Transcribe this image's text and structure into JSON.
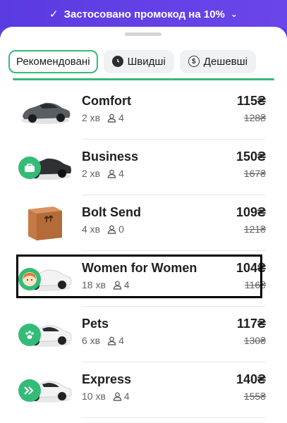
{
  "banner": {
    "text": "Застосовано промокод на 10%"
  },
  "filters": [
    {
      "label": "Рекомендовані",
      "active": true
    },
    {
      "label": "Швидші",
      "icon": "clock-icon"
    },
    {
      "label": "Дешевші",
      "icon": "dollar-icon"
    }
  ],
  "rides": [
    {
      "name": "Comfort",
      "eta": "2 хв",
      "seats": "4",
      "price": "115₴",
      "old_price": "128₴",
      "color": "#5a5d62"
    },
    {
      "name": "Business",
      "eta": "2 хв",
      "seats": "4",
      "price": "150₴",
      "old_price": "167₴",
      "color": "#2e3033",
      "badge_icon": "briefcase-icon"
    },
    {
      "name": "Bolt Send",
      "eta": "4 хв",
      "seats": "0",
      "price": "109₴",
      "old_price": "121₴",
      "color": "#c47a45"
    },
    {
      "name": "Women for Women",
      "eta": "18 хв",
      "seats": "4",
      "price": "104₴",
      "old_price": "116₴",
      "color": "#f3f3f3",
      "badge_icon": "woman-avatar-icon"
    },
    {
      "name": "Pets",
      "eta": "6 хв",
      "seats": "4",
      "price": "117₴",
      "old_price": "130₴",
      "color": "#f3f3f3",
      "badge_icon": "paw-icon"
    },
    {
      "name": "Express",
      "eta": "10 хв",
      "seats": "4",
      "price": "140₴",
      "old_price": "155₴",
      "color": "#f3f3f3",
      "badge_icon": "chevrons-right-icon"
    }
  ],
  "colors": {
    "accent": "#34bb78",
    "banner": "#5b3fe4"
  }
}
